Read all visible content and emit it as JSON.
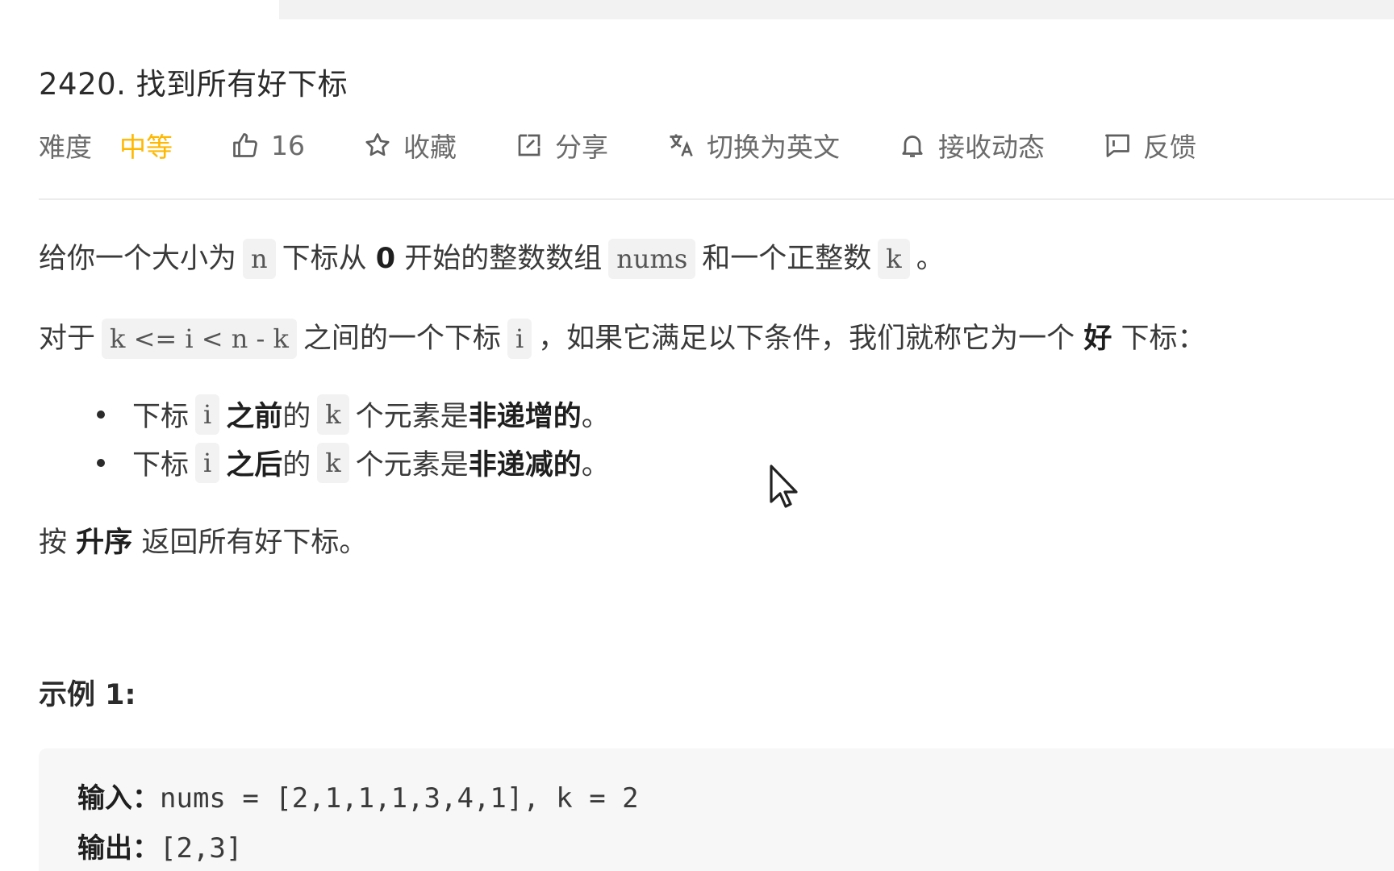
{
  "problem": {
    "title": "2420. 找到所有好下标"
  },
  "meta": {
    "difficulty_label": "难度",
    "difficulty_value": "中等",
    "likes": "16",
    "favorite": "收藏",
    "share": "分享",
    "switch_language": "切换为英文",
    "subscribe": "接收动态",
    "feedback": "反馈"
  },
  "description": {
    "p1": [
      "给你一个大小为",
      "n",
      "下标从",
      "0",
      "开始的整数数组",
      "nums",
      "和一个正整数",
      "k",
      "。"
    ],
    "p2": [
      "对于",
      "k <= i < n - k",
      "之间的一个下标",
      "i",
      "，如果它满足以下条件，我们就称它为一个",
      "好",
      "下标："
    ],
    "bullet1": [
      "下标",
      "i",
      "之前",
      "的",
      "k",
      "个元素是",
      "非递增的",
      "。"
    ],
    "bullet2": [
      "下标",
      "i",
      "之后",
      "的",
      "k",
      "个元素是",
      "非递减的",
      "。"
    ],
    "p3": [
      "按",
      "升序",
      "返回所有好下标。"
    ]
  },
  "example": {
    "heading": "示例 1:",
    "input_label": "输入：",
    "input_value": "nums = [2,1,1,1,3,4,1], k = 2",
    "output_label": "输出：",
    "output_value": "[2,3]"
  },
  "colors": {
    "difficulty_medium": "#ffb800",
    "code_bg": "#f2f2f2",
    "example_bg": "#f7f7f8"
  }
}
